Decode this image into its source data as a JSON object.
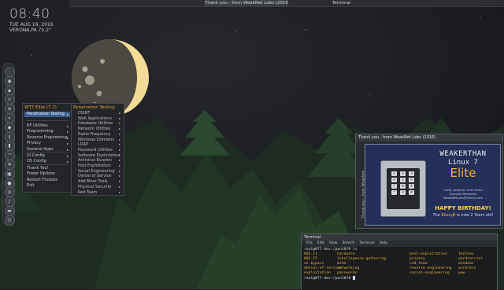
{
  "colors": {
    "sky": "#1a1b1e",
    "moon": "#f2dc96",
    "tree_dark": "#1d2b22",
    "tree_mid": "#233a2a",
    "tree_light": "#2c4b33",
    "menu_accent": "#e8a33b",
    "menu_selected": "#3a5d8c",
    "card_bg": "#242f5a",
    "brand_orange": "#f0b23a"
  },
  "clock": {
    "time": "08:40",
    "date": "TUE AUG 16, 2016",
    "location": "VERONA,PA 75.2°"
  },
  "taskbar": {
    "tasks": [
      {
        "label": "Thank you - from WeakNet Labs (2016)"
      },
      {
        "label": "Terminal"
      }
    ]
  },
  "dock": {
    "icons": [
      {
        "icon": "apps-grid-icon",
        "glyph": "⋮"
      },
      {
        "icon": "globe-icon",
        "glyph": "◉"
      },
      {
        "icon": "terminal-icon",
        "glyph": "▪"
      },
      {
        "icon": "folder-icon",
        "glyph": "▫"
      },
      {
        "icon": "text-editor-icon",
        "glyph": "≡"
      },
      {
        "icon": "network-icon",
        "glyph": "⋄"
      },
      {
        "icon": "shield-icon",
        "glyph": "◆"
      },
      {
        "icon": "key-icon",
        "glyph": "⚷"
      },
      {
        "icon": "chart-icon",
        "glyph": "▮"
      },
      {
        "icon": "wifi-icon",
        "glyph": "◠"
      },
      {
        "icon": "cog-icon",
        "glyph": "✲"
      },
      {
        "icon": "lock-icon",
        "glyph": "▣"
      },
      {
        "icon": "user-icon",
        "glyph": "●"
      },
      {
        "icon": "camera-icon",
        "glyph": "◎"
      },
      {
        "icon": "music-icon",
        "glyph": "♪"
      },
      {
        "icon": "trash-icon",
        "glyph": "▬"
      },
      {
        "icon": "power-icon",
        "glyph": "⏻"
      }
    ]
  },
  "start_menu": {
    "title": "WT7 Elite (7.7)",
    "items": [
      {
        "label": "Penetration Testing",
        "arrow": "▸",
        "selected": true
      },
      {
        "label": "RF Utilities",
        "arrow": "▸"
      },
      {
        "label": "Programming",
        "arrow": "▸"
      },
      {
        "label": "Reverse Engineering",
        "arrow": "▸"
      },
      {
        "label": "Privacy",
        "arrow": "▸"
      },
      {
        "label": "General Apps",
        "arrow": "▸"
      },
      {
        "label": "UI Config",
        "arrow": "▸"
      },
      {
        "label": "OS Config",
        "arrow": "▸"
      },
      {
        "label": "Thank You!",
        "arrow": ""
      },
      {
        "label": "Power Options",
        "arrow": ""
      },
      {
        "label": "Restart Fluxbox",
        "arrow": ""
      },
      {
        "label": "Exit",
        "arrow": ""
      }
    ]
  },
  "submenu": {
    "title": "Penetration Testing",
    "items": [
      {
        "label": "OSINT",
        "arrow": "▸"
      },
      {
        "label": "Web Applications",
        "arrow": "▸"
      },
      {
        "label": "Database Utilities",
        "arrow": "▸"
      },
      {
        "label": "Network Utilities",
        "arrow": "▸"
      },
      {
        "label": "Radio Frequency",
        "arrow": "▸"
      },
      {
        "label": "Windows Domains",
        "arrow": "▸"
      },
      {
        "label": "LDAP",
        "arrow": "▸"
      },
      {
        "label": "Password Utilities",
        "arrow": "▸"
      },
      {
        "label": "Software Exploitation",
        "arrow": "▸"
      },
      {
        "label": "Antivirus Evasion",
        "arrow": "▸"
      },
      {
        "label": "Post Exploitation",
        "arrow": "▸"
      },
      {
        "label": "Social Engineering",
        "arrow": "▸"
      },
      {
        "label": "Denial of Service",
        "arrow": "▸"
      },
      {
        "label": "Add More Tools",
        "arrow": "▸"
      },
      {
        "label": "Physical Security",
        "arrow": "▸"
      },
      {
        "label": "Red Team",
        "arrow": "▸"
      }
    ]
  },
  "thank_you_window": {
    "title": "Thank you - from WeakNet Labs (2016)",
    "side_text": "Thank you - from WeakNet",
    "brand_line1": "WEAKERTHAN",
    "brand_line2": "Linux 7",
    "brand_line3": "Elite",
    "small_line1": "Code, graphics and music",
    "small_line2": "Douglas Berdeaux",
    "small_line3": "WeakNetLabs@Gmail.com",
    "birthday": "HAPPY BIRTHDAY!",
    "sub_pre": "The ",
    "sub_name": "BlizzyB",
    "sub_post": " is now 2 Years old!",
    "keypad": [
      "1",
      "2",
      "3",
      "4",
      "5",
      "6",
      "7",
      "8",
      "9",
      "*",
      "0",
      "#"
    ]
  },
  "terminal": {
    "title": "Terminal",
    "menu": [
      "File",
      "Edit",
      "View",
      "Search",
      "Terminal",
      "Help"
    ],
    "prompt1": "root@WT7-dev:/pwn10f# ls",
    "columns": [
      [
        "802.11",
        "802.15",
        "av-bypass",
        "denial-of-service",
        "exploitation"
      ],
      [
        "hardware",
        "intelligence-gathering",
        "mitm",
        "networking",
        "passwords"
      ],
      [
        "post-exploitation",
        "privacy",
        "red-team",
        "reverse-engineering",
        "social-engineering"
      ],
      [
        "toolbox",
        "wardcarrier",
        "windows",
        "wireless",
        "www"
      ]
    ],
    "prompt2": "root@WT7-dev:/pwn10f#"
  }
}
